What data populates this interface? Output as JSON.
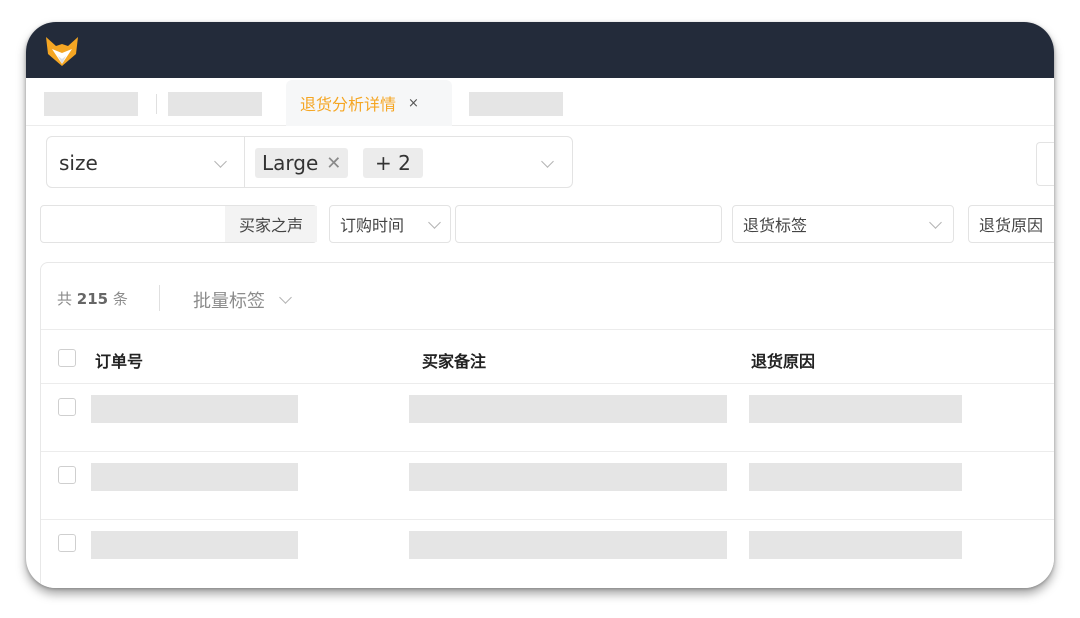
{
  "tabs": {
    "active_label": "退货分析详情",
    "close_icon": "×"
  },
  "filter_bar": {
    "field_select": "size",
    "selected_tag": "Large",
    "more_tag": "+ 2"
  },
  "search_filters": {
    "buyer_voice_label": "买家之声",
    "order_time_label": "订购时间",
    "return_tag_placeholder": "退货标签",
    "return_reason_label": "退货原因"
  },
  "table": {
    "count_prefix": "共",
    "count_value": "215",
    "count_suffix": "条",
    "batch_tag_label": "批量标签",
    "columns": [
      "订单号",
      "买家备注",
      "退货原因"
    ],
    "row_count": 3
  },
  "colors": {
    "topbar": "#232b3a",
    "accent": "#f5a623"
  },
  "icons": [
    "fox-logo-icon",
    "close-icon",
    "chevron-down-icon",
    "checkbox-icon"
  ]
}
